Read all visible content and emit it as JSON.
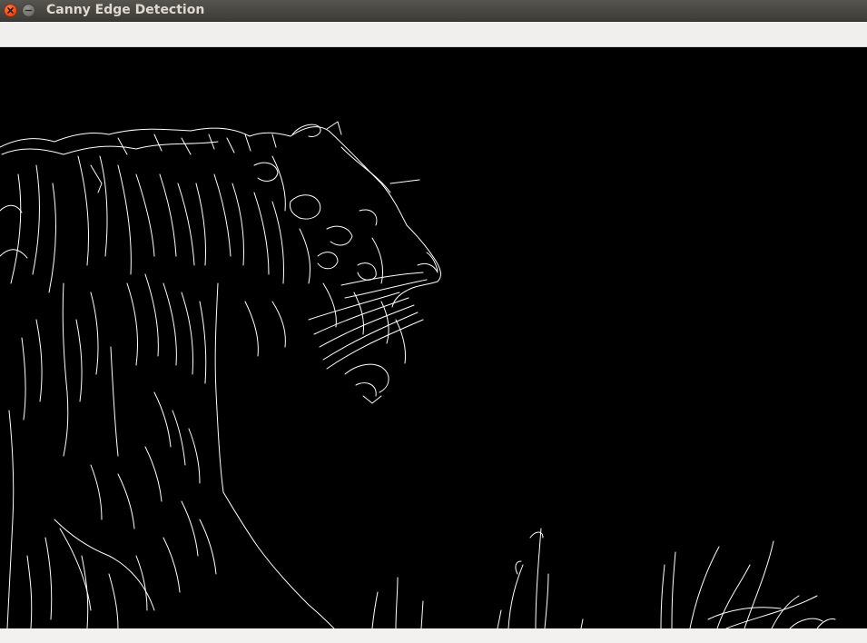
{
  "window": {
    "title": "Canny Edge Detection",
    "close_icon": "close-icon",
    "minimize_icon": "minimize-icon"
  },
  "image": {
    "description_icon": "edge-image",
    "background": "#000000",
    "edge_color": "#ffffff"
  },
  "colors": {
    "titlebar": "#3c3b37",
    "title_text": "#dfdbd2",
    "close": "#e2491b",
    "frame": "#f2f1f0"
  }
}
